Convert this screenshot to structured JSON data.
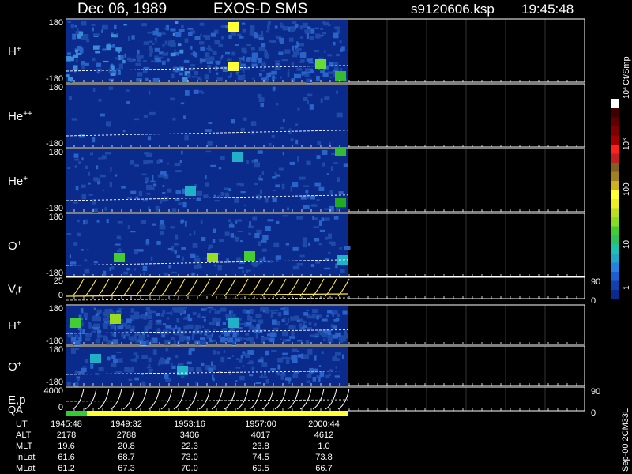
{
  "header": {
    "date": "Dec 06, 1989",
    "instrument": "EXOS-D SMS",
    "file": "s9120606.ksp",
    "time": "19:45:48"
  },
  "colors": {
    "background": "#000000",
    "data_bg": "#0a2a8c",
    "white": "#ffffff",
    "yellow": "#ffff33",
    "green": "#33cc33",
    "trace": "#ffe84a"
  },
  "chart_data": {
    "type": "heatmap",
    "panels": [
      {
        "id": "h_plus_1",
        "label": "H",
        "sup": "+",
        "ytop": "180",
        "ybot": "-180"
      },
      {
        "id": "he_pp",
        "label": "He",
        "sup": "++",
        "ytop": "180",
        "ybot": "-180"
      },
      {
        "id": "he_plus",
        "label": "He",
        "sup": "+",
        "ytop": "180",
        "ybot": "-180"
      },
      {
        "id": "o_plus_1",
        "label": "O",
        "sup": "+",
        "ytop": "180",
        "ybot": "-180"
      },
      {
        "id": "vr",
        "label": "V,r",
        "sup": "",
        "ytop": "25",
        "ybot": "0",
        "right_top": "90",
        "right_bot": "0"
      },
      {
        "id": "h_plus_2",
        "label": "H",
        "sup": "+",
        "ytop": "180",
        "ybot": "-180"
      },
      {
        "id": "o_plus_2",
        "label": "O",
        "sup": "+",
        "ytop": "180",
        "ybot": "-180"
      },
      {
        "id": "ep",
        "label": "E,p",
        "sup": "",
        "ytop": "4000",
        "ybot": "0",
        "right_top": "90",
        "right_bot": "0"
      }
    ],
    "qa_label": "QA",
    "colorbar": {
      "unit": "Ct/Smp",
      "tick_labels": [
        "1",
        "10",
        "100",
        "10",
        "10"
      ],
      "tick_exponents": [
        "",
        "",
        "",
        "3",
        "4"
      ]
    },
    "side_text": "Sep-00  2CM33L",
    "ephemeris": {
      "row_labels": [
        "UT",
        "ALT",
        "MLT",
        "InLat",
        "MLat"
      ],
      "columns": [
        [
          "1945:48",
          "2178",
          "19.6",
          "61.6",
          "61.2"
        ],
        [
          "1949:32",
          "2788",
          "20.8",
          "68.7",
          "67.3"
        ],
        [
          "1953:16",
          "3406",
          "22.3",
          "73.0",
          "70.0"
        ],
        [
          "1957:00",
          "4017",
          "23.8",
          "74.5",
          "69.5"
        ],
        [
          "2000:44",
          "4612",
          "1.0",
          "73.8",
          "66.7"
        ]
      ]
    }
  }
}
